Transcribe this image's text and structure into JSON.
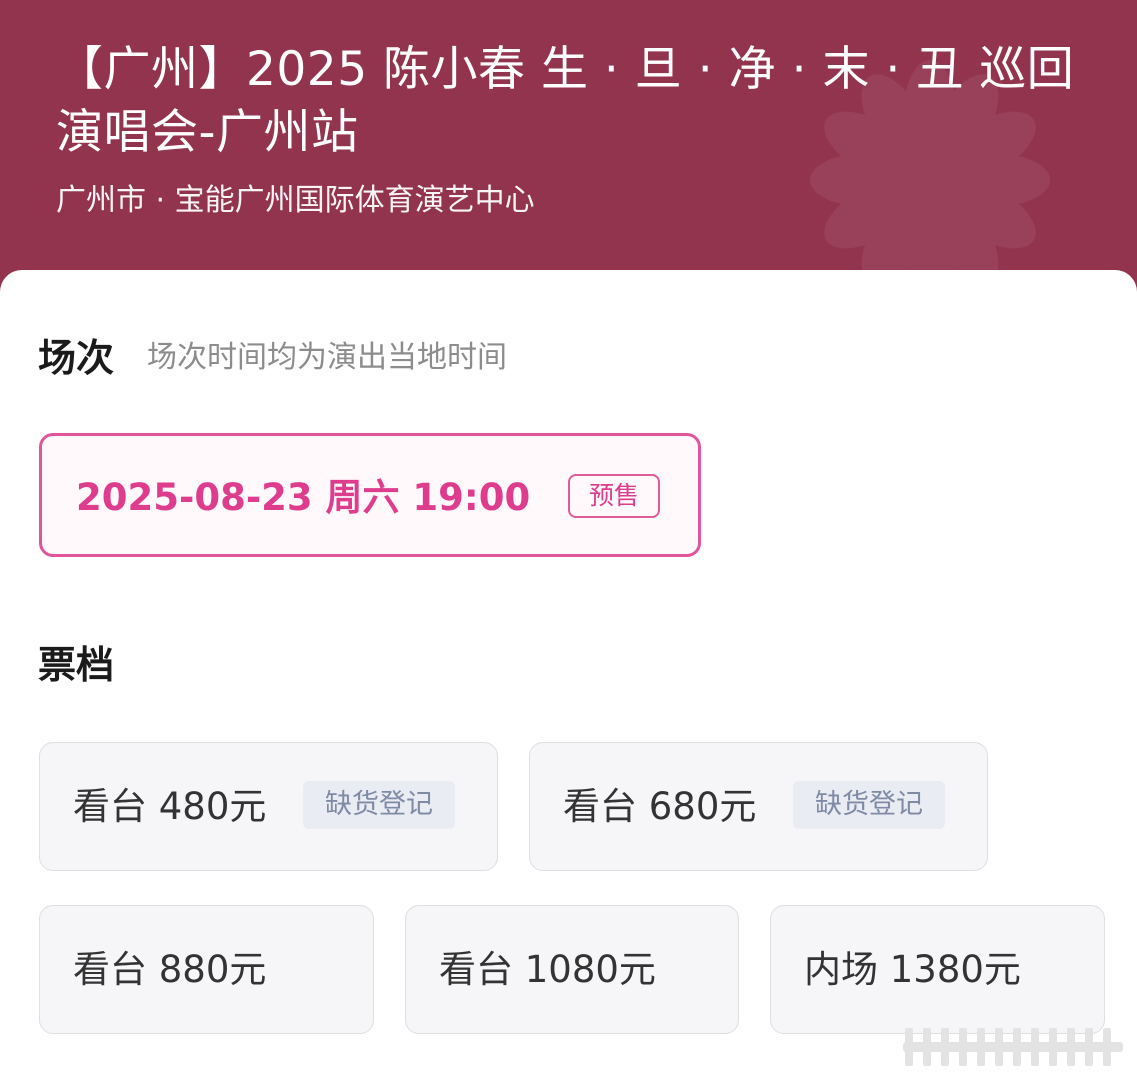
{
  "event": {
    "title": "【广州】2025 陈小春 生 · 旦 · 净 · 末 · 丑 巡回演唱会-广州站",
    "venue": "广州市 · 宝能广州国际体育演艺中心"
  },
  "sessions": {
    "heading": "场次",
    "note": "场次时间均为演出当地时间",
    "items": [
      {
        "datetime": "2025-08-23  周六 19:00",
        "badge": "预售"
      }
    ]
  },
  "tickets": {
    "heading": "票档",
    "items": [
      {
        "label": "看台 480元",
        "tag": "缺货登记"
      },
      {
        "label": "看台 680元",
        "tag": "缺货登记"
      },
      {
        "label": "看台 880元"
      },
      {
        "label": "看台 1080元"
      },
      {
        "label": "内场 1380元"
      }
    ]
  },
  "colors": {
    "header_bg": "#93344f",
    "accent_pink": "#dd3d8c",
    "card_bg": "#f6f6f8",
    "tag_bg": "#e9ecf3"
  }
}
